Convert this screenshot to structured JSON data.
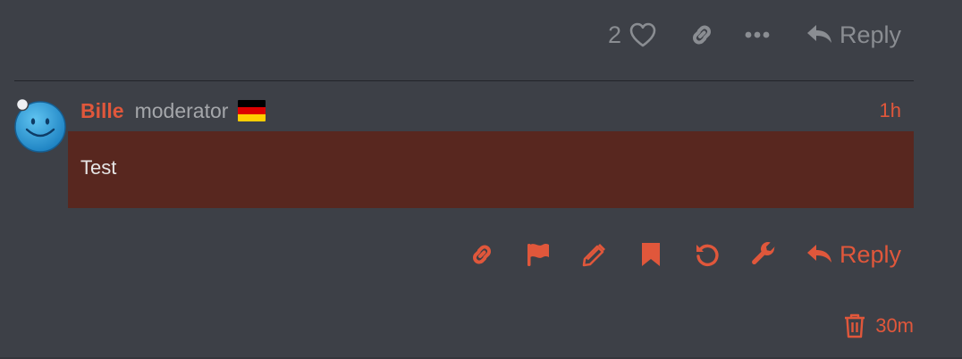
{
  "top_actions": {
    "like_count": "2",
    "like_icon": "heart-icon",
    "link_icon": "link-icon",
    "more_icon": "ellipsis-icon",
    "reply_icon": "reply-arrow-icon",
    "reply_label": "Reply"
  },
  "post": {
    "avatar_icon": "smiley-avatar",
    "username": "Bille",
    "user_title": "moderator",
    "flag": "germany-flag",
    "time": "1h",
    "body": "Test",
    "body_background": "#58271f",
    "accent": "#e0573b"
  },
  "post_actions": {
    "icons": [
      "link-icon",
      "flag-icon",
      "pencil-icon",
      "bookmark-icon",
      "undo-icon",
      "wrench-icon"
    ],
    "reply_label": "Reply"
  },
  "deleted": {
    "icon": "trash-icon",
    "time": "30m"
  }
}
